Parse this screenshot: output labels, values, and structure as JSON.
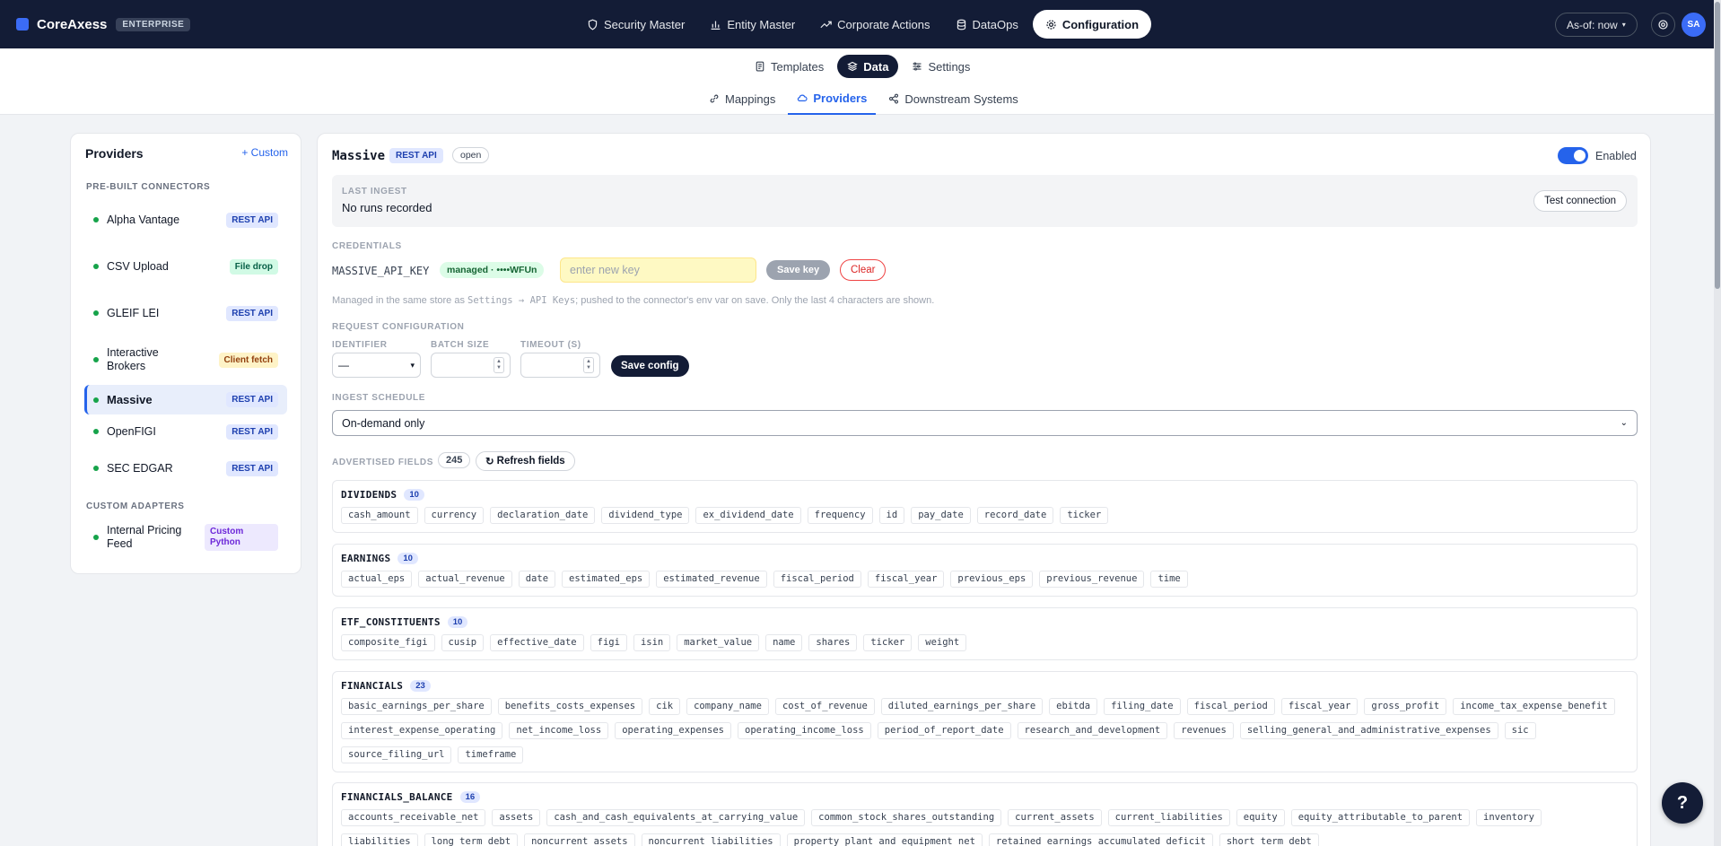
{
  "app": {
    "name": "CoreAxess",
    "edition": "ENTERPRISE"
  },
  "topnav": [
    {
      "label": "Security Master",
      "icon": "shield-icon"
    },
    {
      "label": "Entity Master",
      "icon": "chart-icon"
    },
    {
      "label": "Corporate Actions",
      "icon": "trend-icon"
    },
    {
      "label": "DataOps",
      "icon": "database-icon"
    },
    {
      "label": "Configuration",
      "icon": "gear-icon",
      "active": true
    }
  ],
  "asof": {
    "label": "As-of: now"
  },
  "user": {
    "initials": "SA"
  },
  "subtabs": [
    {
      "label": "Templates"
    },
    {
      "label": "Data",
      "active": true
    },
    {
      "label": "Settings"
    }
  ],
  "subtabs2": [
    {
      "label": "Mappings"
    },
    {
      "label": "Providers",
      "active": true
    },
    {
      "label": "Downstream Systems"
    }
  ],
  "providers": {
    "title": "Providers",
    "custom_label": "+ Custom",
    "prebuilt_header": "PRE-BUILT CONNECTORS",
    "custom_header": "CUSTOM ADAPTERS",
    "items": [
      {
        "name": "Alpha Vantage",
        "badge": "REST API"
      },
      {
        "name": "CSV Upload",
        "badge": "File drop"
      },
      {
        "name": "GLEIF LEI",
        "badge": "REST API"
      },
      {
        "name": "Interactive Brokers",
        "badge": "Client fetch"
      },
      {
        "name": "Massive",
        "badge": "REST API",
        "selected": true
      },
      {
        "name": "OpenFIGI",
        "badge": "REST API"
      },
      {
        "name": "SEC EDGAR",
        "badge": "REST API"
      }
    ],
    "custom_items": [
      {
        "name": "Internal Pricing Feed",
        "badge": "Custom Python"
      }
    ]
  },
  "detail": {
    "name": "Massive",
    "type_badge": "REST API",
    "access_badge": "open",
    "enabled_label": "Enabled",
    "enabled": true,
    "last_ingest_label": "LAST INGEST",
    "last_ingest_value": "No runs recorded",
    "test_label": "Test connection",
    "credentials_label": "CREDENTIALS",
    "key_name": "MASSIVE_API_KEY",
    "key_status": "managed · ••••WFUn",
    "key_placeholder": "enter new key",
    "save_key_label": "Save key",
    "clear_label": "Clear",
    "note_pre": "Managed in the same store as ",
    "note_code": "Settings → API Keys",
    "note_post": "; pushed to the connector's env var on save. Only the last 4 characters are shown.",
    "request_config_label": "REQUEST CONFIGURATION",
    "identifier_label": "IDENTIFIER",
    "identifier_value": "—",
    "batch_label": "BATCH SIZE",
    "timeout_label": "TIMEOUT (S)",
    "save_config_label": "Save config",
    "schedule_label": "INGEST SCHEDULE",
    "schedule_value": "On-demand only",
    "fields_label": "ADVERTISED FIELDS",
    "fields_count": "245",
    "refresh_label": "Refresh fields"
  },
  "groups": [
    {
      "name": "DIVIDENDS",
      "count": "10",
      "fields": [
        "cash_amount",
        "currency",
        "declaration_date",
        "dividend_type",
        "ex_dividend_date",
        "frequency",
        "id",
        "pay_date",
        "record_date",
        "ticker"
      ]
    },
    {
      "name": "EARNINGS",
      "count": "10",
      "fields": [
        "actual_eps",
        "actual_revenue",
        "date",
        "estimated_eps",
        "estimated_revenue",
        "fiscal_period",
        "fiscal_year",
        "previous_eps",
        "previous_revenue",
        "time"
      ]
    },
    {
      "name": "ETF_CONSTITUENTS",
      "count": "10",
      "fields": [
        "composite_figi",
        "cusip",
        "effective_date",
        "figi",
        "isin",
        "market_value",
        "name",
        "shares",
        "ticker",
        "weight"
      ]
    },
    {
      "name": "FINANCIALS",
      "count": "23",
      "fields": [
        "basic_earnings_per_share",
        "benefits_costs_expenses",
        "cik",
        "company_name",
        "cost_of_revenue",
        "diluted_earnings_per_share",
        "ebitda",
        "filing_date",
        "fiscal_period",
        "fiscal_year",
        "gross_profit",
        "income_tax_expense_benefit",
        "interest_expense_operating",
        "net_income_loss",
        "operating_expenses",
        "operating_income_loss",
        "period_of_report_date",
        "research_and_development",
        "revenues",
        "selling_general_and_administrative_expenses",
        "sic",
        "source_filing_url",
        "timeframe"
      ]
    },
    {
      "name": "FINANCIALS_BALANCE",
      "count": "16",
      "fields": [
        "accounts_receivable_net",
        "assets",
        "cash_and_cash_equivalents_at_carrying_value",
        "common_stock_shares_outstanding",
        "current_assets",
        "current_liabilities",
        "equity",
        "equity_attributable_to_parent",
        "inventory",
        "liabilities",
        "long_term_debt",
        "noncurrent_assets",
        "noncurrent_liabilities",
        "property_plant_and_equipment_net",
        "retained_earnings_accumulated_deficit",
        "short_term_debt"
      ]
    }
  ],
  "help": {
    "label": "?"
  }
}
